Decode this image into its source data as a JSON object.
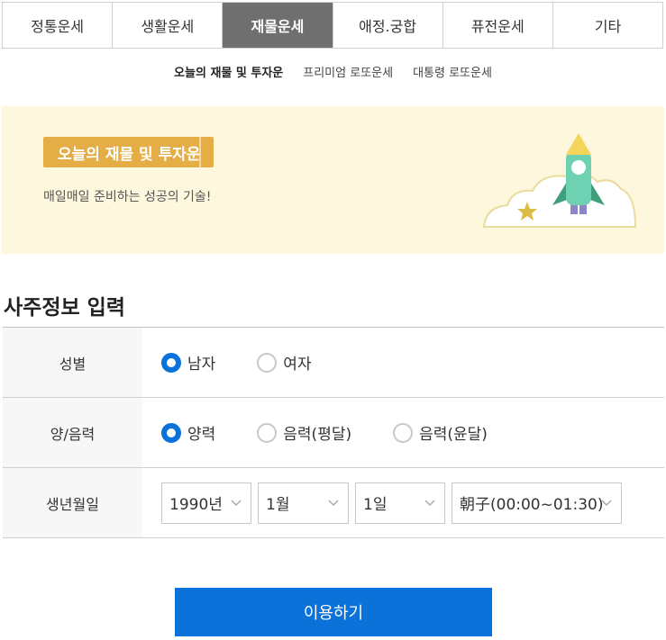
{
  "tabs": [
    {
      "label": "정통운세"
    },
    {
      "label": "생활운세"
    },
    {
      "label": "재물운세"
    },
    {
      "label": "애정.궁합"
    },
    {
      "label": "퓨전운세"
    },
    {
      "label": "기타"
    }
  ],
  "active_tab": "재물운세",
  "subnav": [
    {
      "label": "오늘의 재물 및 투자운"
    },
    {
      "label": "프리미엄 로또운세"
    },
    {
      "label": "대통령 로또운세"
    }
  ],
  "banner": {
    "title": "오늘의 재물 및 투자운",
    "description": "매일매일 준비하는 성공의 기술!",
    "illustration_icon": "rocket-on-cloud-icon"
  },
  "section_title": "사주정보 입력",
  "form": {
    "gender": {
      "label": "성별",
      "options": [
        "남자",
        "여자"
      ],
      "selected": "남자"
    },
    "calendar": {
      "label": "양/음력",
      "options": [
        "양력",
        "음력(평달)",
        "음력(윤달)"
      ],
      "selected": "양력"
    },
    "birth": {
      "label": "생년월일",
      "year": "1990년",
      "month": "1월",
      "day": "1일",
      "time": "朝子(00:00~01:30)"
    }
  },
  "submit_label": "이용하기",
  "colors": {
    "accent": "#0a72d8",
    "banner_bg": "#fdf7dd",
    "badge": "#e4ad45",
    "active_tab": "#6f6f6f"
  }
}
